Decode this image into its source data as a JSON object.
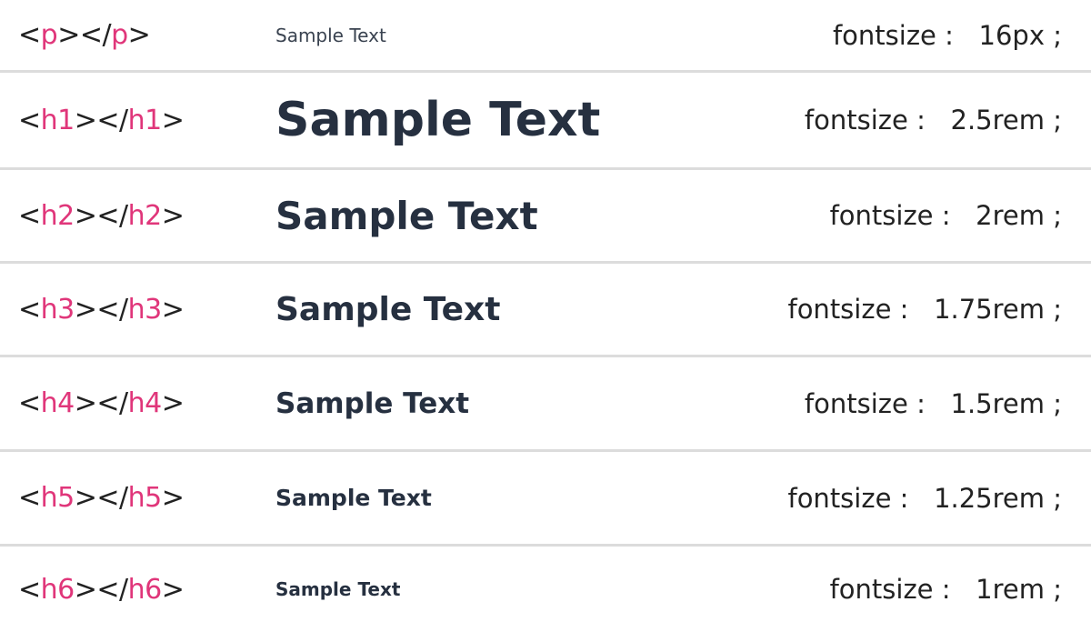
{
  "rows": [
    {
      "tag": "p",
      "sample": "Sample Text",
      "label": "fontsize :",
      "value": "16px ;"
    },
    {
      "tag": "h1",
      "sample": "Sample Text",
      "label": "fontsize :",
      "value": "2.5rem ;"
    },
    {
      "tag": "h2",
      "sample": "Sample Text",
      "label": "fontsize :",
      "value": "2rem ;"
    },
    {
      "tag": "h3",
      "sample": "Sample Text",
      "label": "fontsize :",
      "value": "1.75rem ;"
    },
    {
      "tag": "h4",
      "sample": "Sample Text",
      "label": "fontsize :",
      "value": "1.5rem ;"
    },
    {
      "tag": "h5",
      "sample": "Sample Text",
      "label": "fontsize :",
      "value": "1.25rem ;"
    },
    {
      "tag": "h6",
      "sample": "Sample Text",
      "label": "fontsize :",
      "value": "1rem ;"
    }
  ],
  "colors": {
    "tag_name": "#e0367a",
    "sample_text": "#263040",
    "divider": "#dcdcdc"
  }
}
